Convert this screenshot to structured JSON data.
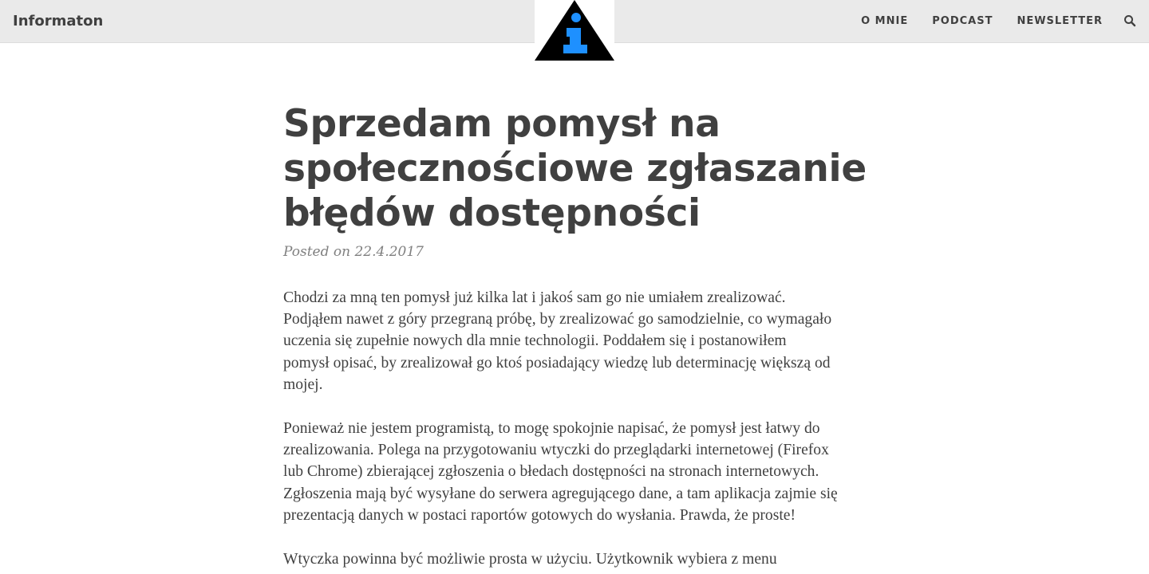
{
  "navbar": {
    "brand": "Informaton",
    "links": [
      "O MNIE",
      "PODCAST",
      "NEWSLETTER"
    ]
  },
  "post": {
    "title_lines": [
      "Sprzedam pomysł na",
      "społecznościowe zgłaszanie",
      "błędów dostępności"
    ],
    "meta": "Posted on 22.4.2017",
    "paragraphs": [
      [
        "Chodzi za mną ten pomysł już kilka lat i jakoś sam go nie umiałem zrealizować.",
        "Podjąłem nawet z góry przegraną próbę, by zrealizować go samodzielnie, co wymagało",
        "uczenia się zupełnie nowych dla mnie technologii. Poddałem się i postanowiłem",
        "pomysł opisać, by zrealizował go ktoś posiadający wiedzę lub determinację większą od",
        "mojej."
      ],
      [
        "Ponieważ nie jestem programistą, to mogę spokojnie napisać, że pomysł jest łatwy do",
        "zrealizowania. Polega na przygotowaniu wtyczki do przeglądarki internetowej (Firefox",
        "lub Chrome) zbierającej zgłoszenia o błedach dostępności na stronach internetowych.",
        "Zgłoszenia mają być wysyłane do serwera agregującego dane, a tam aplikacja zajmie się",
        "prezentacją danych w postaci raportów gotowych do wysłania. Prawda, że proste!"
      ],
      [
        "Wtyczka powinna być możliwie prosta w użyciu. Użytkownik wybiera z menu"
      ]
    ]
  },
  "colors": {
    "navbar_bg": "#eaeaea",
    "text": "#404040",
    "meta": "#808080",
    "logo_triangle": "#000000",
    "logo_i": "#1e90ff"
  },
  "icons": {
    "logo": "info-triangle-icon",
    "search": "search-icon"
  }
}
